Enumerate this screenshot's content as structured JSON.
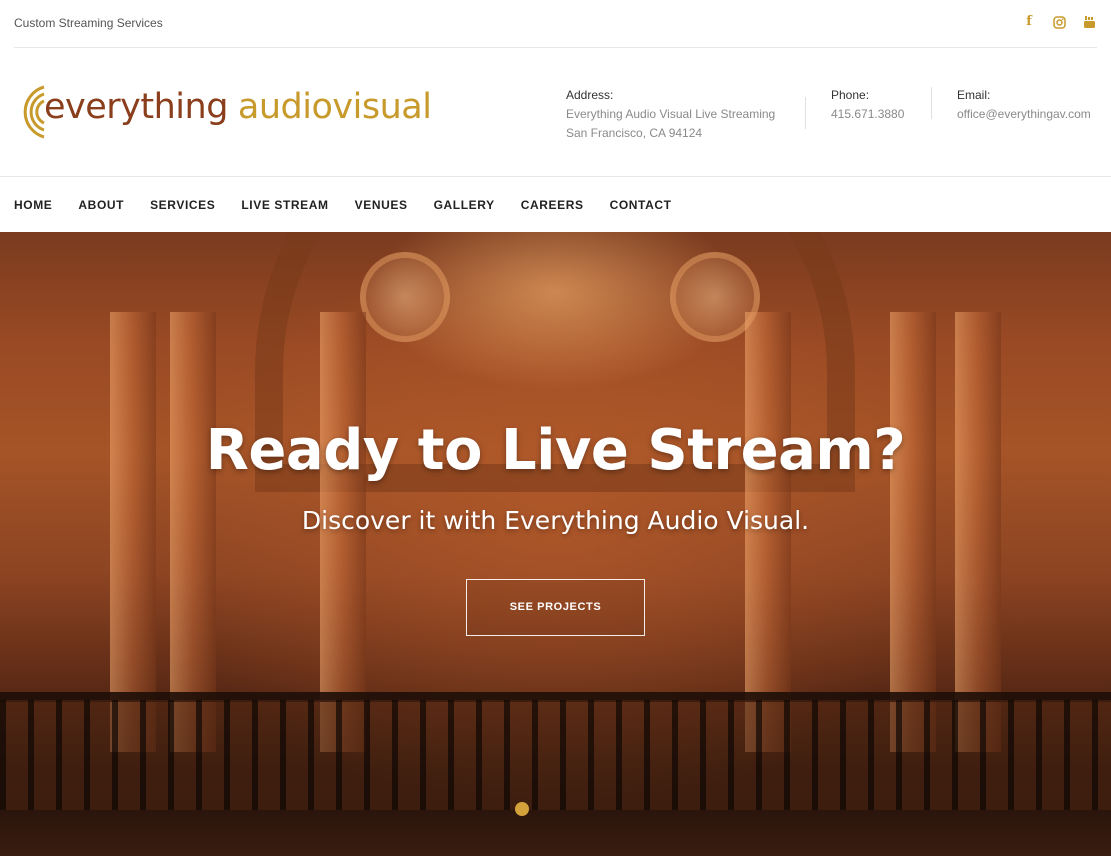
{
  "topbar": {
    "tagline": "Custom Streaming Services",
    "social": [
      {
        "icon": "facebook-icon",
        "glyph": "f"
      },
      {
        "icon": "instagram-icon"
      },
      {
        "icon": "youtube-icon"
      }
    ]
  },
  "logo": {
    "word1": "everything",
    "word2": "audiovisual",
    "colors": {
      "word1": "#8a3e1c",
      "word2": "#c79a2b",
      "arcs": "#c79a2b"
    }
  },
  "contact": {
    "address_label": "Address:",
    "address_line1": "Everything Audio Visual Live Streaming",
    "address_line2": "San Francisco, CA 94124",
    "phone_label": "Phone:",
    "phone": "415.671.3880",
    "email_label": "Email:",
    "email": "office@everythingav.com"
  },
  "nav": {
    "items": [
      "HOME",
      "ABOUT",
      "SERVICES",
      "LIVE STREAM",
      "VENUES",
      "GALLERY",
      "CAREERS",
      "CONTACT"
    ]
  },
  "hero": {
    "title": "Ready to Live Stream?",
    "subtitle": "Discover it with Everything Audio Visual.",
    "button": "SEE PROJECTS",
    "accent": "#d4a23a"
  }
}
